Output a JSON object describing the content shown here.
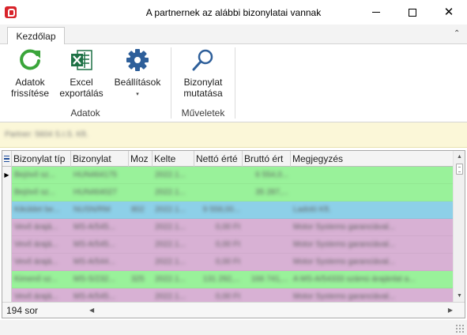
{
  "window": {
    "title": "A partnernek az alábbi bizonylatai vannak",
    "minimize_glyph": "",
    "close_glyph": "✕"
  },
  "ribbon": {
    "tab_label": "Kezdőlap",
    "collapse_glyph": "⌃",
    "groups": [
      {
        "label": "Adatok",
        "buttons": [
          {
            "line1": "Adatok",
            "line2": "frissítése",
            "icon": "refresh-icon",
            "color": "#3aa53a"
          },
          {
            "line1": "Excel",
            "line2": "exportálás",
            "icon": "excel-icon",
            "color": "#1e7145"
          },
          {
            "line1": "Beállítások",
            "line2": "▾",
            "icon": "gear-icon",
            "color": "#2e5f9a"
          }
        ]
      },
      {
        "label": "Műveletek",
        "buttons": [
          {
            "line1": "Bizonylat",
            "line2": "mutatása",
            "icon": "magnifier-icon",
            "color": "#2e5f9a"
          }
        ]
      }
    ]
  },
  "partner_bar": {
    "text": "Partner: 5604 S.I.S. Kft."
  },
  "grid": {
    "columns": [
      "Bizonylat típ",
      "Bizonylat",
      "Moz",
      "Kelte",
      "Nettó érté",
      "Bruttó ért",
      "Megjegyzés"
    ],
    "row_indicator": "▶",
    "rows": [
      {
        "color": "#99f29a",
        "cells": [
          "Bejövő sz...",
          "HUN464175",
          "",
          "2022.1...",
          "",
          "6 554,0...",
          ""
        ]
      },
      {
        "color": "#99f29a",
        "cells": [
          "Bejövő sz...",
          "HUN464027",
          "",
          "2022.1...",
          "",
          "35 287,...",
          ""
        ]
      },
      {
        "color": "#8dd0e8",
        "cells": [
          "Kiküldet be...",
          "NUSN/RM",
          "802",
          "2022.1...",
          "9 558,00...",
          "",
          "Ladoló Kft."
        ]
      },
      {
        "color": "#d8b1d4",
        "cells": [
          "Vevő árajá...",
          "MS-A/545...",
          "",
          "2022.1...",
          "0,00 Ft",
          "",
          "Motor Systems garanciával..."
        ]
      },
      {
        "color": "#d8b1d4",
        "cells": [
          "Vevő árajá...",
          "MS-A/545...",
          "",
          "2022.1...",
          "0,00 Ft",
          "",
          "Motor Systems garanciával..."
        ]
      },
      {
        "color": "#d8b1d4",
        "cells": [
          "Vevő árajá...",
          "MS-A/544...",
          "",
          "2022.1...",
          "0,00 Ft",
          "",
          "Motor Systems garanciával..."
        ]
      },
      {
        "color": "#99f29a",
        "cells": [
          "Kimenő sz...",
          "MS-S/232...",
          "325",
          "2022.1...",
          "131 292,...",
          "166 741,...",
          "A MS-A/54333 számú árajánlat a..."
        ]
      },
      {
        "color": "#d8b1d4",
        "cells": [
          "Vevő árajá...",
          "MS-A/545...",
          "",
          "2022.1...",
          "0,00 Ft",
          "",
          "Motor Systems garanciával..."
        ]
      }
    ],
    "row_count_label": "194 sor"
  }
}
